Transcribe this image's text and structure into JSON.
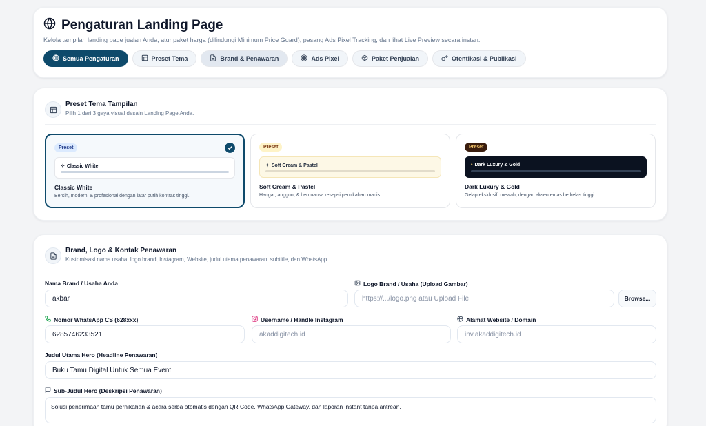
{
  "header": {
    "title": "Pengaturan Landing Page",
    "description": "Kelola tampilan landing page jualan Anda, atur paket harga (dilindungi Minimum Price Guard), pasang Ads Pixel Tracking, dan lihat Live Preview secara instan.",
    "tabs": [
      {
        "label": "Semua Pengaturan",
        "icon": "globe-icon"
      },
      {
        "label": "Preset Tema",
        "icon": "layout-icon"
      },
      {
        "label": "Brand & Penawaran",
        "icon": "document-icon"
      },
      {
        "label": "Ads Pixel",
        "icon": "target-icon"
      },
      {
        "label": "Paket Penjualan",
        "icon": "box-icon"
      },
      {
        "label": "Otentikasi & Publikasi",
        "icon": "key-icon"
      }
    ]
  },
  "preset": {
    "title": "Preset Tema Tampilan",
    "subtitle": "Pilih 1 dari 3 gaya visual desain Landing Page Anda.",
    "themes": [
      {
        "badge": "Preset",
        "preview_label": "Classic White",
        "name": "Classic White",
        "description": "Bersih, modern, & profesional dengan latar putih kontras tinggi.",
        "selected": true
      },
      {
        "badge": "Preset",
        "preview_label": "Soft Cream & Pastel",
        "name": "Soft Cream & Pastel",
        "description": "Hangat, anggun, & bernuansa resepsi pernikahan manis.",
        "selected": false
      },
      {
        "badge": "Preset",
        "preview_label": "Dark Luxury & Gold",
        "name": "Dark Luxury & Gold",
        "description": "Gelap eksklusif, mewah, dengan aksen emas berkelas tinggi.",
        "selected": false
      }
    ]
  },
  "brand": {
    "title": "Brand, Logo & Kontak Penawaran",
    "subtitle": "Kustomisasi nama usaha, logo brand, Instagram, Website, judul utama penawaran, subtitle, dan WhatsApp.",
    "brand_name_label": "Nama Brand / Usaha Anda",
    "brand_name_value": "akbar",
    "logo_label": "Logo Brand / Usaha (Upload Gambar)",
    "logo_placeholder": "https://.../logo.png atau Upload File",
    "browse_label": "Browse...",
    "whatsapp_label": "Nomor WhatsApp CS (628xxx)",
    "whatsapp_value": "6285746233521",
    "instagram_label": "Username / Handle Instagram",
    "instagram_placeholder": "akaddigitech.id",
    "website_label": "Alamat Website / Domain",
    "website_placeholder": "inv.akaddigitech.id",
    "headline_label": "Judul Utama Hero (Headline Penawaran)",
    "headline_value": "Buku Tamu Digital Untuk Semua Event",
    "subheadline_label": "Sub-Judul Hero (Deskripsi Penawaran)",
    "subheadline_value": "Solusi penerimaan tamu pernikahan & acara serba otomatis dengan QR Code, WhatsApp Gateway, dan laporan instant tanpa antrean."
  },
  "colors": {
    "primary": "#0e4a6b",
    "cream": "#fdf8e6",
    "dark": "#0b1220",
    "gold": "#e8c66b"
  }
}
